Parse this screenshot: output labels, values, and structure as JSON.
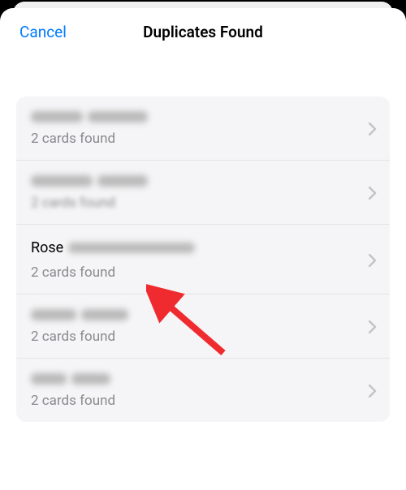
{
  "nav": {
    "cancel": "Cancel",
    "title": "Duplicates Found"
  },
  "list": {
    "items": [
      {
        "visibleName": "",
        "blurred": true,
        "blurWidths": [
          64,
          74
        ],
        "subtitle": "2 cards found"
      },
      {
        "visibleName": "",
        "blurred": true,
        "blurWidths": [
          76,
          62
        ],
        "subtitle": "2 cards found",
        "blurSubtitle": true
      },
      {
        "visibleName": "Rose",
        "blurred": true,
        "blurWidths": [
          156
        ],
        "subtitle": "2 cards found"
      },
      {
        "visibleName": "",
        "blurred": true,
        "blurWidths": [
          56,
          58
        ],
        "subtitle": "2 cards found"
      },
      {
        "visibleName": "",
        "blurred": true,
        "blurWidths": [
          44,
          48
        ],
        "subtitle": "2 cards found"
      }
    ]
  }
}
